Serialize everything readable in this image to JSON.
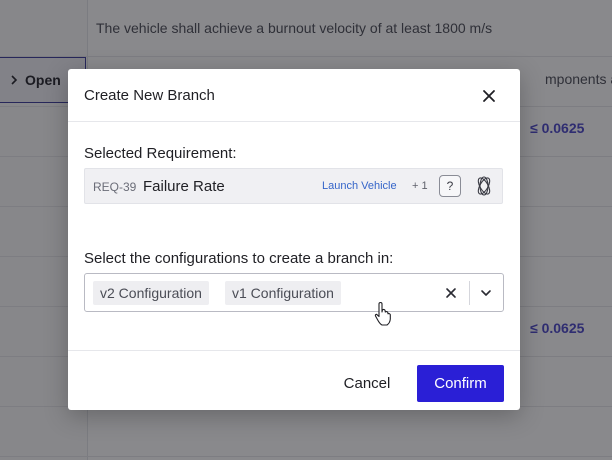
{
  "background": {
    "row1_text": "The vehicle shall achieve a burnout velocity of at least 1800 m/s",
    "row2_text": "mponents and",
    "open_button_label": "Open",
    "value_1": "≤ 0.0625",
    "value_2": "≤ 0.0625"
  },
  "dialog": {
    "title": "Create New Branch",
    "selected_requirement_label": "Selected Requirement:",
    "requirement": {
      "id": "REQ-39",
      "name": "Failure Rate",
      "tag": "Launch Vehicle",
      "more_count": "+ 1",
      "help_glyph": "?"
    },
    "configurations_label": "Select the configurations to create a branch in:",
    "selected_configurations": [
      "v2 Configuration",
      "v1 Configuration"
    ],
    "cancel_label": "Cancel",
    "confirm_label": "Confirm"
  },
  "colors": {
    "accent": "#2a1fd6",
    "tag_blue": "#3565c9",
    "value_purple": "#4a46c8",
    "overlay": "rgba(20,20,26,0.5)"
  },
  "icons": [
    "close-icon",
    "chevron-right-icon",
    "question-icon",
    "atom-icon",
    "clear-icon",
    "chevron-down-icon",
    "pointer-cursor-icon"
  ]
}
